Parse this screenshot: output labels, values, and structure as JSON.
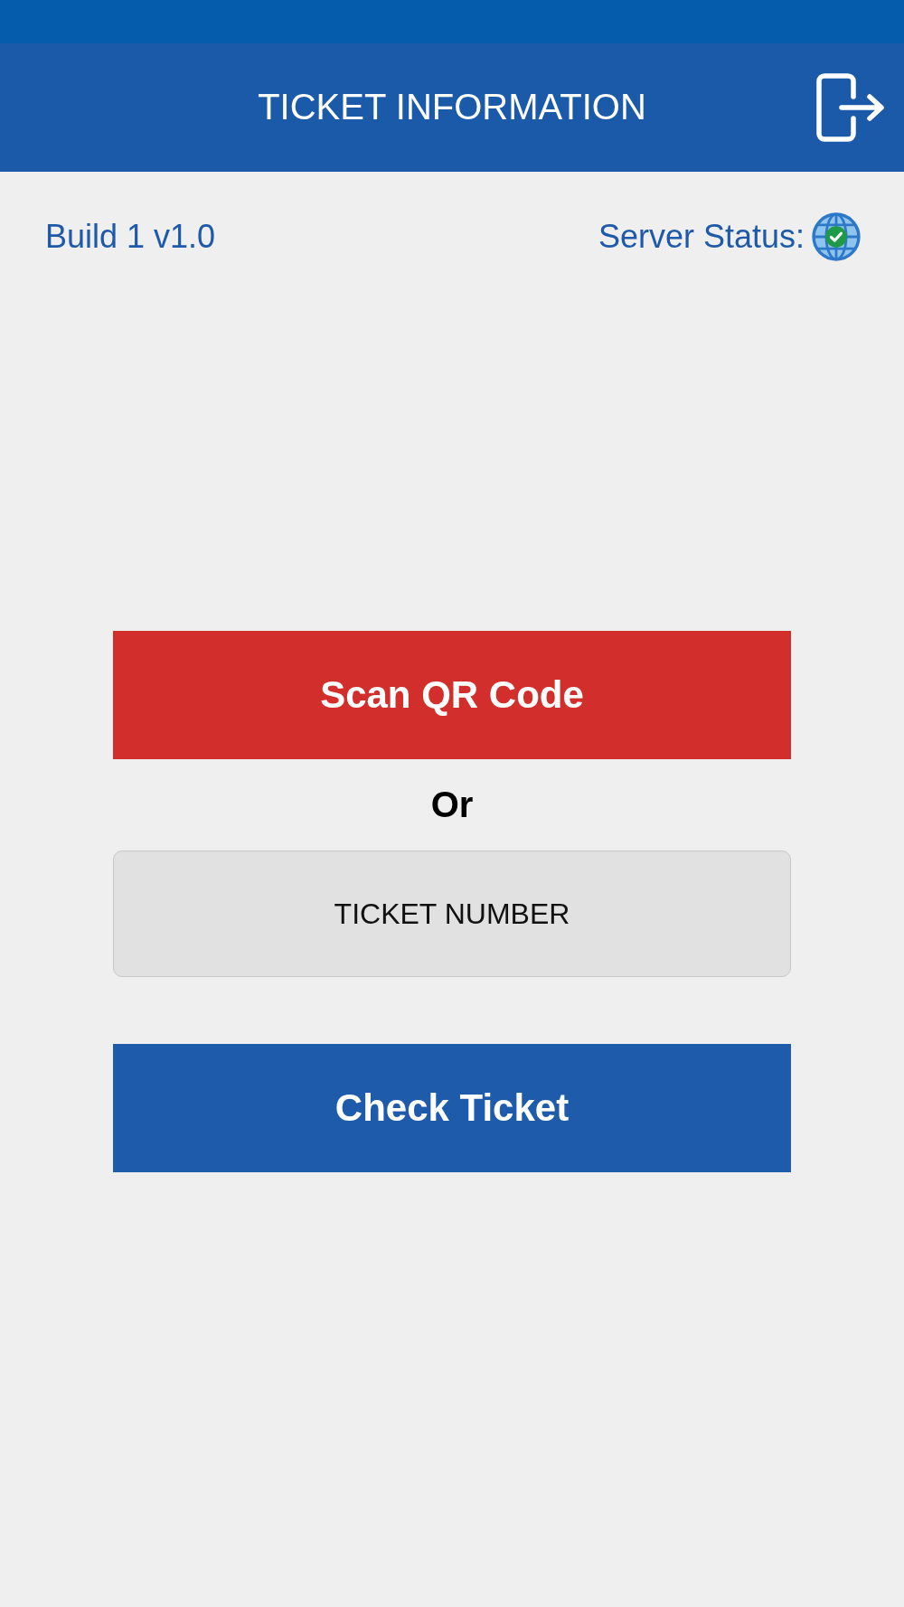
{
  "header": {
    "title": "TICKET INFORMATION"
  },
  "info": {
    "build": "Build 1 v1.0",
    "server_status_label": "Server Status:",
    "server_online": true
  },
  "scan_button": {
    "label": "Scan QR Code"
  },
  "separator": "Or",
  "ticket_field": {
    "placeholder": "TICKET NUMBER"
  },
  "check_button": {
    "label": "Check Ticket"
  }
}
